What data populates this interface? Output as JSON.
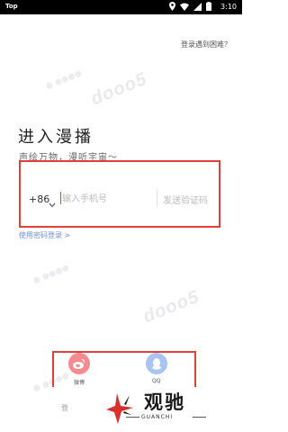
{
  "status_bar": {
    "app_label": "Top",
    "time": "3:10"
  },
  "header": {
    "help_link": "登录遇到困难？"
  },
  "login": {
    "title": "进入漫播",
    "subtitle": "声绘万物，漫听宇宙～",
    "country_code": "+86",
    "phone_placeholder": "输入手机号",
    "send_code_label": "发送验证码",
    "password_login_label": "使用密码登录 >"
  },
  "social": {
    "weibo_label": "微博",
    "qq_label": "QQ",
    "weibo_color": "#f58b8e",
    "qq_color": "#a9c4f2",
    "partial_text": "登"
  },
  "brand": {
    "name": "观驰",
    "sub": "GUANCHI"
  },
  "colors": {
    "highlight_border": "#e0403a",
    "link": "#6f8fd8",
    "cursor": "#7a54e8"
  }
}
